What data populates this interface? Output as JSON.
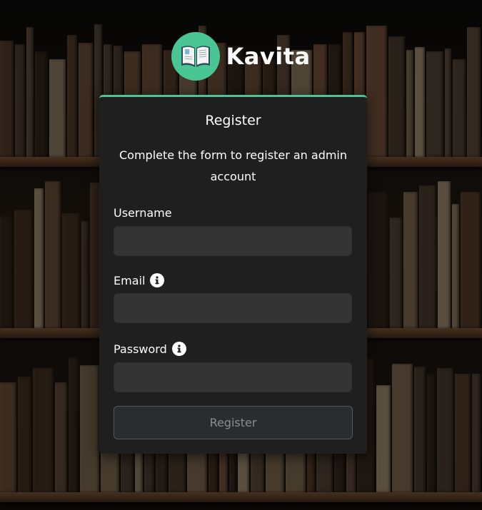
{
  "brand": {
    "name": "Kavita",
    "logo_icon": "open-book-icon",
    "accent_color": "#4ac694"
  },
  "form": {
    "title": "Register",
    "subtitle": "Complete the form to register an admin account",
    "fields": {
      "username": {
        "label": "Username",
        "value": "",
        "placeholder": ""
      },
      "email": {
        "label": "Email",
        "value": "",
        "placeholder": "",
        "info_icon": "info-icon"
      },
      "password": {
        "label": "Password",
        "value": "",
        "placeholder": "",
        "info_icon": "info-icon"
      }
    },
    "submit_label": "Register"
  },
  "background": {
    "theme": "bookshelf",
    "colors": {
      "card": "#1f1f1f",
      "input": "#343434",
      "button": "#2a2c30"
    }
  }
}
